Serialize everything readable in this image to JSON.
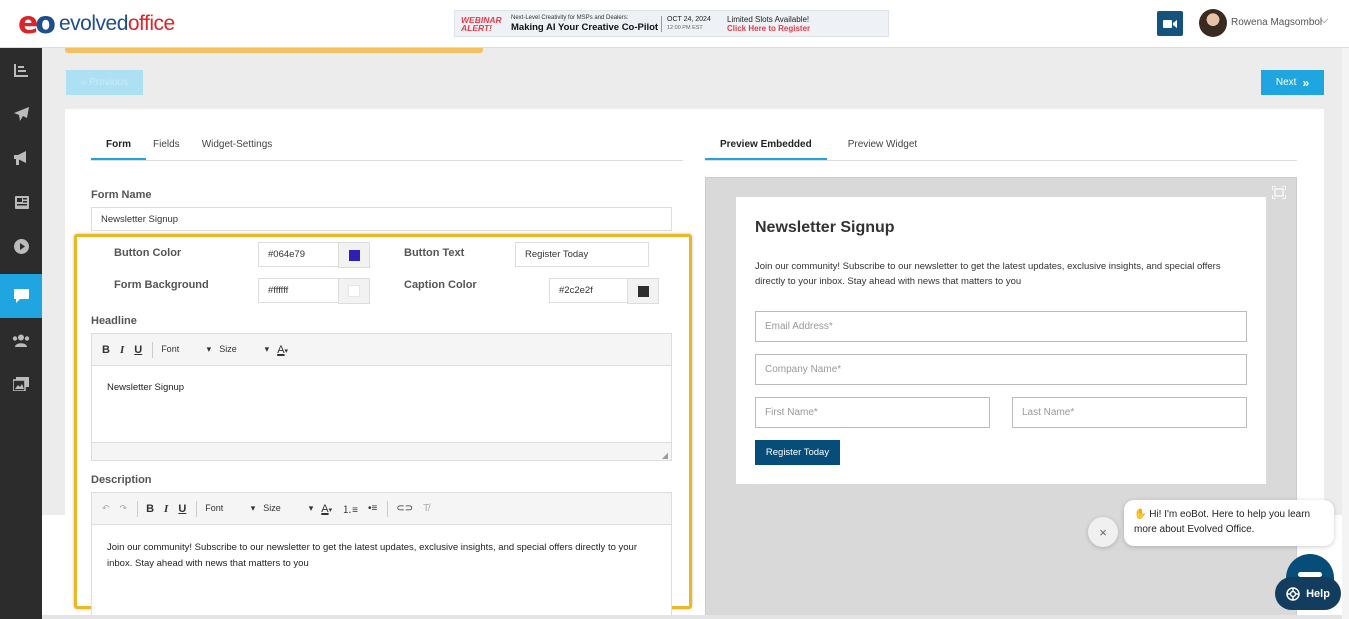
{
  "header": {
    "logo": {
      "mark": "eo",
      "word_part1": "evolved",
      "word_part2": "office"
    },
    "banner": {
      "alert": "WEBINAR ALERT!",
      "subtitle": "Next-Level Creativity for MSPs and Dealers:",
      "title": "Making AI Your Creative Co-Pilot",
      "date": "OCT 24, 2024",
      "time": "12:00 PM EST",
      "slots": "Limited Slots Available!",
      "cta": "Click Here to Register"
    },
    "user_name": "Rowena Magsombol"
  },
  "sidebar": {
    "items": [
      {
        "icon": "chart-bar-icon",
        "active": false
      },
      {
        "icon": "paper-plane-icon",
        "active": false
      },
      {
        "icon": "megaphone-icon",
        "active": false
      },
      {
        "icon": "newspaper-icon",
        "active": false
      },
      {
        "icon": "play-circle-icon",
        "active": false
      },
      {
        "icon": "chat-bubble-icon",
        "active": true
      },
      {
        "icon": "users-icon",
        "active": false
      },
      {
        "icon": "images-icon",
        "active": false
      }
    ]
  },
  "nav": {
    "previous_label": "« Previous",
    "next_label": "Next"
  },
  "left_tabs": [
    {
      "label": "Form",
      "active": true
    },
    {
      "label": "Fields",
      "active": false
    },
    {
      "label": "Widget-Settings",
      "active": false
    }
  ],
  "right_tabs": [
    {
      "label": "Preview Embedded",
      "active": true
    },
    {
      "label": "Preview Widget",
      "active": false
    }
  ],
  "form": {
    "form_name_label": "Form Name",
    "form_name_value": "Newsletter Signup",
    "button_color_label": "Button Color",
    "button_color_value": "#064e79",
    "button_text_label": "Button Text",
    "button_text_value": "Register Today",
    "form_background_label": "Form Background",
    "form_background_value": "#ffffff",
    "caption_color_label": "Caption Color",
    "caption_color_value": "#2c2e2f",
    "headline_label": "Headline",
    "headline_text": "Newsletter Signup",
    "description_label": "Description",
    "description_text": "Join our community! Subscribe to our newsletter to get the latest updates, exclusive insights, and special offers directly to your inbox. Stay ahead with news that matters to you"
  },
  "editor_toolbar": {
    "font": "Font",
    "size": "Size"
  },
  "preview": {
    "title": "Newsletter Signup",
    "description": "Join our community! Subscribe to our newsletter to get the latest updates, exclusive insights, and special offers directly to your inbox. Stay ahead with news that matters to you",
    "email_placeholder": "Email Address*",
    "company_placeholder": "Company Name*",
    "first_name_placeholder": "First Name*",
    "last_name_placeholder": "Last Name*",
    "button_label": "Register Today"
  },
  "chat": {
    "message": "Hi! I'm eoBot. Here to help you learn more about Evolved Office.",
    "close_label": "×",
    "help_label": "Help"
  },
  "colors": {
    "accent": "#1fa6e0",
    "sidebar": "#2c2c2c",
    "highlight": "#e9b824",
    "button": "#064e79"
  }
}
